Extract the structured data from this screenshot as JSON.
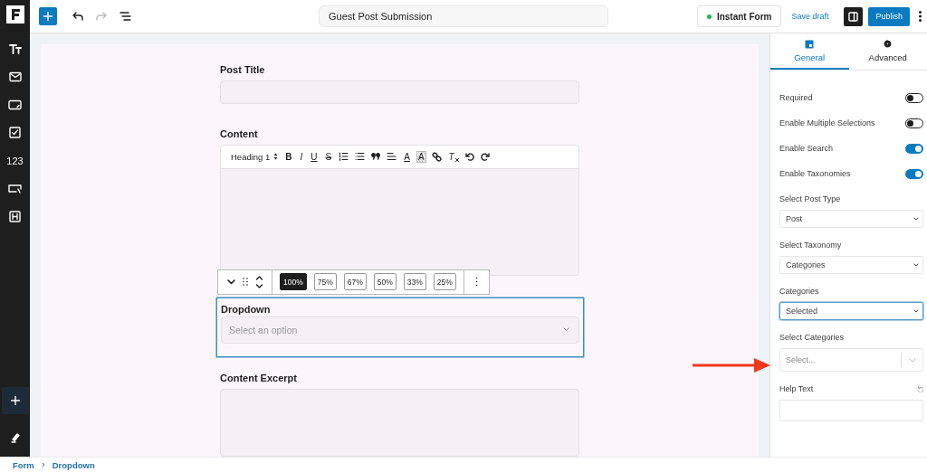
{
  "rail": {
    "numeric_tool": "123"
  },
  "header": {
    "title": "Guest Post Submission",
    "undo": {
      "disabled": false
    },
    "redo": {
      "disabled": true
    },
    "instant_form": "Instant Form",
    "save_draft": "Save draft",
    "publish": "Publish"
  },
  "form": {
    "fields": [
      {
        "kind": "text",
        "label": "Post Title"
      },
      {
        "kind": "editor",
        "label": "Content",
        "format": "Heading 1",
        "tools": [
          {
            "kind": "bold",
            "label": "B"
          },
          {
            "kind": "italic",
            "label": "I"
          },
          {
            "kind": "underline",
            "label": "U"
          },
          {
            "kind": "strike",
            "label": "S"
          },
          {
            "kind": "ordered-list"
          },
          {
            "kind": "bullet-list"
          },
          {
            "kind": "quote"
          },
          {
            "kind": "align"
          },
          {
            "kind": "text-color",
            "label": "A"
          },
          {
            "kind": "highlight",
            "label": "A"
          },
          {
            "kind": "link"
          },
          {
            "kind": "clear-format",
            "label": "T"
          },
          {
            "kind": "undo"
          },
          {
            "kind": "redo"
          }
        ]
      },
      {
        "kind": "select",
        "label": "Dropdown",
        "placeholder": "Select an option",
        "selected": true
      },
      {
        "kind": "textarea",
        "label": "Content Excerpt"
      }
    ]
  },
  "block_toolbar": {
    "widths": [
      {
        "label": "100%",
        "selected": true
      },
      {
        "label": "75%",
        "selected": false
      },
      {
        "label": "67%",
        "selected": false
      },
      {
        "label": "50%",
        "selected": false
      },
      {
        "label": "33%",
        "selected": false
      },
      {
        "label": "25%",
        "selected": false
      }
    ]
  },
  "sidebar": {
    "tabs": [
      {
        "label": "General",
        "selected": true
      },
      {
        "label": "Advanced",
        "selected": false
      }
    ],
    "settings": [
      {
        "kind": "toggle",
        "label": "Required",
        "on": false
      },
      {
        "kind": "toggle",
        "label": "Enable Multiple Selections",
        "on": false
      },
      {
        "kind": "toggle",
        "label": "Enable Search",
        "on": true
      },
      {
        "kind": "toggle",
        "label": "Enable Taxonomies",
        "on": true
      },
      {
        "kind": "select",
        "label": "Select Post Type",
        "value": "Post",
        "focused": false
      },
      {
        "kind": "select",
        "label": "Select Taxonomy",
        "value": "Categories",
        "focused": false
      },
      {
        "kind": "select",
        "label": "Categories",
        "value": "Selected",
        "focused": true
      },
      {
        "kind": "combobox",
        "label": "Select Categories",
        "placeholder": "Select..."
      },
      {
        "kind": "text",
        "label": "Help Text"
      }
    ]
  },
  "breadcrumb": [
    "Form",
    "Dropdown"
  ]
}
